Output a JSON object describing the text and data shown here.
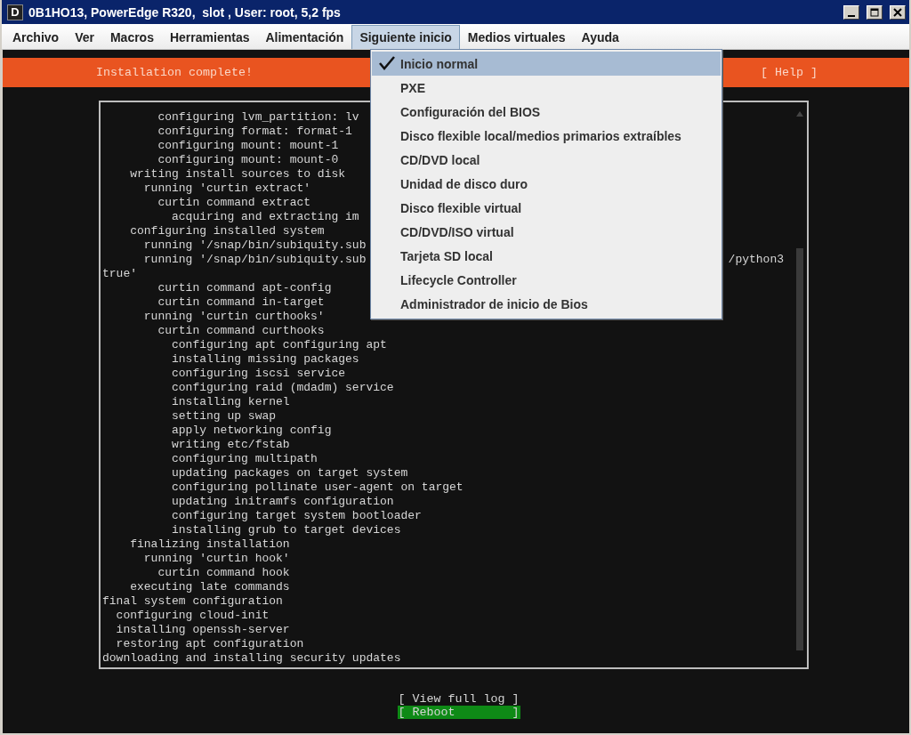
{
  "window": {
    "app_icon": "D",
    "title": "0B1HO13, PowerEdge R320,  slot , User: root, 5,2 fps"
  },
  "menu_bar": [
    {
      "label": "Archivo",
      "selected": false
    },
    {
      "label": "Ver",
      "selected": false
    },
    {
      "label": "Macros",
      "selected": false
    },
    {
      "label": "Herramientas",
      "selected": false
    },
    {
      "label": "Alimentación",
      "selected": false
    },
    {
      "label": "Siguiente inicio",
      "selected": true
    },
    {
      "label": "Medios virtuales",
      "selected": false
    },
    {
      "label": "Ayuda",
      "selected": false
    }
  ],
  "open_menu": [
    {
      "label": "Inicio normal",
      "checked": true,
      "selected": true
    },
    {
      "label": "PXE",
      "checked": false,
      "selected": false
    },
    {
      "label": "Configuración del BIOS",
      "checked": false,
      "selected": false
    },
    {
      "label": "Disco flexible local/medios primarios extraíbles",
      "checked": false,
      "selected": false
    },
    {
      "label": "CD/DVD local",
      "checked": false,
      "selected": false
    },
    {
      "label": "Unidad de disco duro",
      "checked": false,
      "selected": false
    },
    {
      "label": "Disco flexible virtual",
      "checked": false,
      "selected": false
    },
    {
      "label": "CD/DVD/ISO virtual",
      "checked": false,
      "selected": false
    },
    {
      "label": "Tarjeta SD local",
      "checked": false,
      "selected": false
    },
    {
      "label": "Lifecycle Controller",
      "checked": false,
      "selected": false
    },
    {
      "label": "Administrador de inicio de Bios",
      "checked": false,
      "selected": false
    }
  ],
  "console": {
    "header": {
      "title": "Installation complete!",
      "help": "[ Help ]"
    },
    "log_lines": [
      {
        "text": "        configuring lvm_partition: lv"
      },
      {
        "text": "        configuring format: format-1"
      },
      {
        "text": "        configuring mount: mount-1"
      },
      {
        "text": "        configuring mount: mount-0"
      },
      {
        "text": "    writing install sources to disk"
      },
      {
        "text": "      running 'curtin extract'"
      },
      {
        "text": "        curtin command extract"
      },
      {
        "text": "          acquiring and extracting im"
      },
      {
        "text": "    configuring installed system"
      },
      {
        "text": "      running '/snap/bin/subiquity.sub"
      },
      {
        "text": "      running '/snap/bin/subiquity.sub",
        "tail": "/python3"
      },
      {
        "text": "true'"
      },
      {
        "text": "        curtin command apt-config"
      },
      {
        "text": "        curtin command in-target"
      },
      {
        "text": "      running 'curtin curthooks'"
      },
      {
        "text": "        curtin command curthooks"
      },
      {
        "text": "          configuring apt configuring apt"
      },
      {
        "text": "          installing missing packages"
      },
      {
        "text": "          configuring iscsi service"
      },
      {
        "text": "          configuring raid (mdadm) service"
      },
      {
        "text": "          installing kernel"
      },
      {
        "text": "          setting up swap"
      },
      {
        "text": "          apply networking config"
      },
      {
        "text": "          writing etc/fstab"
      },
      {
        "text": "          configuring multipath"
      },
      {
        "text": "          updating packages on target system"
      },
      {
        "text": "          configuring pollinate user-agent on target"
      },
      {
        "text": "          updating initramfs configuration"
      },
      {
        "text": "          configuring target system bootloader"
      },
      {
        "text": "          installing grub to target devices"
      },
      {
        "text": "    finalizing installation"
      },
      {
        "text": "      running 'curtin hook'"
      },
      {
        "text": "        curtin command hook"
      },
      {
        "text": "    executing late commands"
      },
      {
        "text": "final system configuration"
      },
      {
        "text": "  configuring cloud-init"
      },
      {
        "text": "  installing openssh-server"
      },
      {
        "text": "  restoring apt configuration"
      },
      {
        "text": "downloading and installing security updates"
      }
    ],
    "buttons": [
      {
        "label": "[ View full log ]",
        "selected": false
      },
      {
        "label": "[ Reboot        ]",
        "selected": true
      }
    ]
  }
}
